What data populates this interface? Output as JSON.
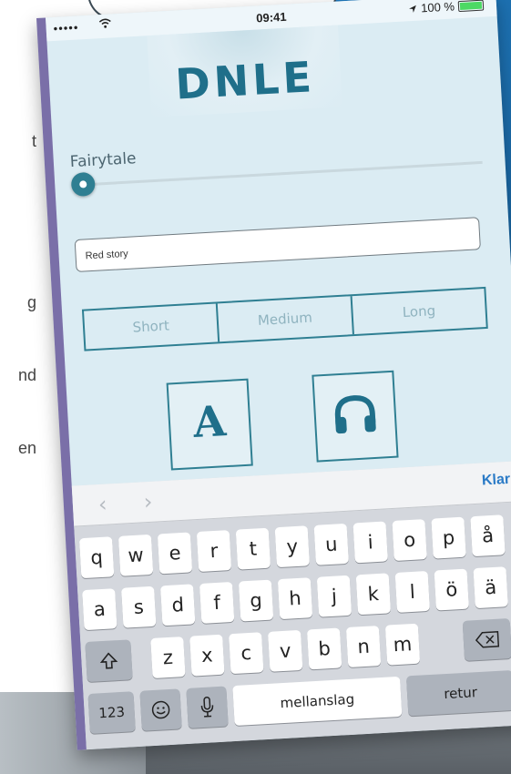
{
  "side_text": [
    "t",
    "g",
    "nd",
    "en"
  ],
  "status_bar": {
    "signal": "•••••",
    "time": "09:41",
    "battery": "100 %"
  },
  "app": {
    "logo": "DNLE",
    "genre_label": "Fairytale",
    "genre_slider_value": 0,
    "story_input_value": "Red story",
    "length_options": [
      "Short",
      "Medium",
      "Long"
    ],
    "text_mode_glyph": "A",
    "audio_mode_icon": "headphones-icon"
  },
  "keyboard": {
    "prev_arrow": "‹",
    "next_arrow": "›",
    "done_label": "Klar",
    "row1": [
      "q",
      "w",
      "e",
      "r",
      "t",
      "y",
      "u",
      "i",
      "o",
      "p",
      "å"
    ],
    "row2": [
      "a",
      "s",
      "d",
      "f",
      "g",
      "h",
      "j",
      "k",
      "l",
      "ö",
      "ä"
    ],
    "row3": [
      "z",
      "x",
      "c",
      "v",
      "b",
      "n",
      "m"
    ],
    "numbers_label": "123",
    "space_label": "mellanslag",
    "return_label": "retur"
  },
  "colors": {
    "accent": "#2f7f92",
    "logo": "#1f6f8a",
    "background": "#dbecf3",
    "done": "#2a7ac6"
  }
}
